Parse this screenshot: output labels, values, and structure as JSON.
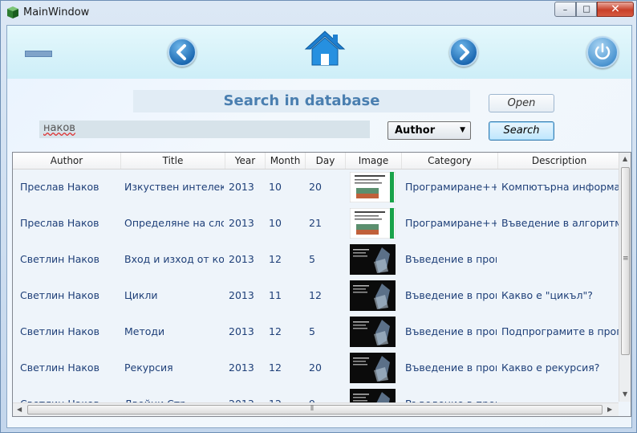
{
  "window": {
    "title": "MainWindow"
  },
  "heading": "Search in database",
  "open_label": "Open",
  "search": {
    "value": "наков",
    "filter_selected": "Author",
    "button_label": "Search"
  },
  "grid": {
    "columns": [
      "Author",
      "Title",
      "Year",
      "Month",
      "Day",
      "Image",
      "Category",
      "Description"
    ],
    "rows": [
      {
        "author": "Преслав Наков",
        "title": "Изкуствен интелект",
        "year": "2013",
        "month": "10",
        "day": "20",
        "image": "light",
        "category": "Програмиране++=...",
        "description": "Компютърна информати"
      },
      {
        "author": "Преслав Наков",
        "title": "Определяне на слож",
        "year": "2013",
        "month": "10",
        "day": "21",
        "image": "light",
        "category": "Програмиране++=...",
        "description": "Въведение в алгоритми"
      },
      {
        "author": "Светлин Наков",
        "title": "Вход и изход от кон",
        "year": "2013",
        "month": "12",
        "day": "5",
        "image": "dark",
        "category": "Въведение в прогр",
        "description": ""
      },
      {
        "author": "Светлин Наков",
        "title": "Цикли",
        "year": "2013",
        "month": "11",
        "day": "12",
        "image": "dark",
        "category": "Въведение в прогр",
        "description": "Какво е \"цикъл\"?"
      },
      {
        "author": "Светлин Наков",
        "title": "Методи",
        "year": "2013",
        "month": "12",
        "day": "5",
        "image": "dark",
        "category": "Въведение в прогр",
        "description": "Подпрограмите в прогр"
      },
      {
        "author": "Светлин Наков",
        "title": "Рекурсия",
        "year": "2013",
        "month": "12",
        "day": "20",
        "image": "dark",
        "category": "Въведение в прогр",
        "description": "Какво е рекурсия?"
      },
      {
        "author": "Светлин Наков",
        "title": "Двойни Стр...",
        "year": "2013",
        "month": "12",
        "day": "9",
        "image": "dark",
        "category": "Въведение в прогр",
        "description": ""
      }
    ]
  },
  "colors": {
    "accent": "#1d6ab3",
    "text": "#1e3f78",
    "heading": "#4a7fb0"
  }
}
